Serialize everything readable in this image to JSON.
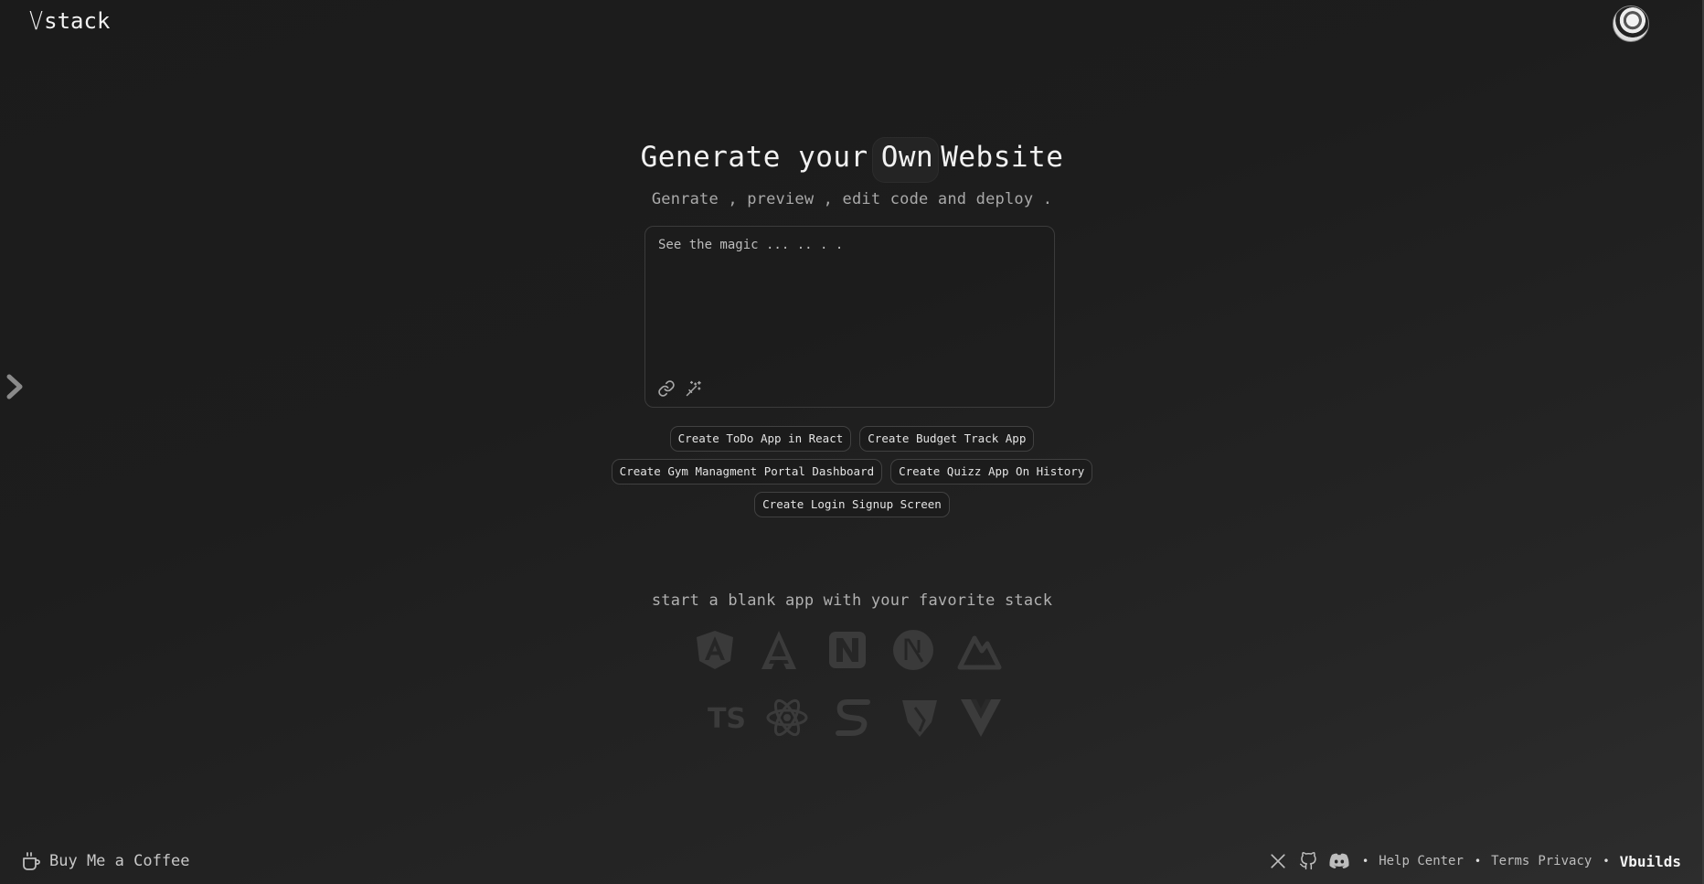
{
  "header": {
    "logo_mark": "V",
    "logo_text": "stack"
  },
  "hero": {
    "title_start": "Generate your",
    "title_highlight": "Own",
    "title_end": "Website",
    "subtitle": "Genrate , preview , edit code and deploy ."
  },
  "prompt": {
    "placeholder": "See the magic ... .. . ."
  },
  "suggestions": {
    "row1": [
      "Create ToDo App in React",
      "Create Budget Track App"
    ],
    "row2": [
      "Create Gym Managment Portal Dashboard",
      "Create Quizz App On History"
    ],
    "row3": [
      "Create Login Signup Screen"
    ]
  },
  "stack": {
    "heading": "start a blank app with your favorite stack",
    "icons_row1": [
      "angular-icon",
      "analog-icon",
      "nuxt-icon",
      "nextjs-icon",
      "astro-icon"
    ],
    "icons_row2": [
      "typescript-icon",
      "react-icon",
      "solid-icon",
      "qwik-icon",
      "vue-icon"
    ],
    "ts_label": "TS"
  },
  "footer": {
    "coffee_label": "Buy Me a Coffee",
    "help_center": "Help Center",
    "terms": "Terms",
    "privacy": "Privacy",
    "brand": "Vbuilds",
    "separator": "•"
  },
  "colors": {
    "background": "#1d1d1d",
    "text": "#f1f1f1",
    "muted_text": "#a9a9a9",
    "chip_border": "#414141",
    "icon_faded": "#3c3c3c"
  }
}
